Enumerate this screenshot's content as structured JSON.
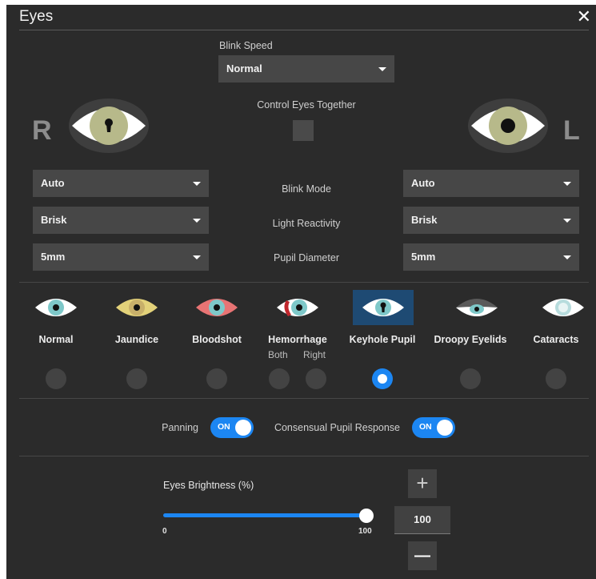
{
  "window": {
    "title": "Eyes",
    "close_glyph": "✕"
  },
  "blink_speed": {
    "label": "Blink Speed",
    "value": "Normal"
  },
  "control_together": {
    "label": "Control Eyes Together",
    "checked": false
  },
  "right_eye": {
    "letter": "R",
    "blink_mode": "Auto",
    "light_reactivity": "Brisk",
    "pupil_diameter": "5mm"
  },
  "left_eye": {
    "letter": "L",
    "blink_mode": "Auto",
    "light_reactivity": "Brisk",
    "pupil_diameter": "5mm"
  },
  "row_labels": {
    "blink_mode": "Blink Mode",
    "light_reactivity": "Light Reactivity",
    "pupil_diameter": "Pupil Diameter"
  },
  "conditions": [
    {
      "label": "Normal",
      "icon": "normal-eye-icon"
    },
    {
      "label": "Jaundice",
      "icon": "jaundice-eye-icon"
    },
    {
      "label": "Bloodshot",
      "icon": "bloodshot-eye-icon"
    },
    {
      "label": "Hemorrhage",
      "icon": "hemorrhage-eye-icon",
      "sub_labels": [
        "Both",
        "Right"
      ]
    },
    {
      "label": "Keyhole Pupil",
      "icon": "keyhole-pupil-eye-icon",
      "selected": true
    },
    {
      "label": "Droopy Eyelids",
      "icon": "droopy-eyelids-eye-icon"
    },
    {
      "label": "Cataracts",
      "icon": "cataracts-eye-icon"
    }
  ],
  "toggles": {
    "panning": {
      "label": "Panning",
      "state": "ON"
    },
    "consensual": {
      "label": "Consensual Pupil Response",
      "state": "ON"
    }
  },
  "brightness": {
    "label": "Eyes Brightness (%)",
    "min": "0",
    "max": "100",
    "value": "100",
    "plus": "+",
    "minus": "—"
  },
  "colors": {
    "accent": "#1c86f2",
    "panel": "#2b2b2b",
    "selected_bg": "#1e4a73",
    "iris": "#b7b98a"
  }
}
